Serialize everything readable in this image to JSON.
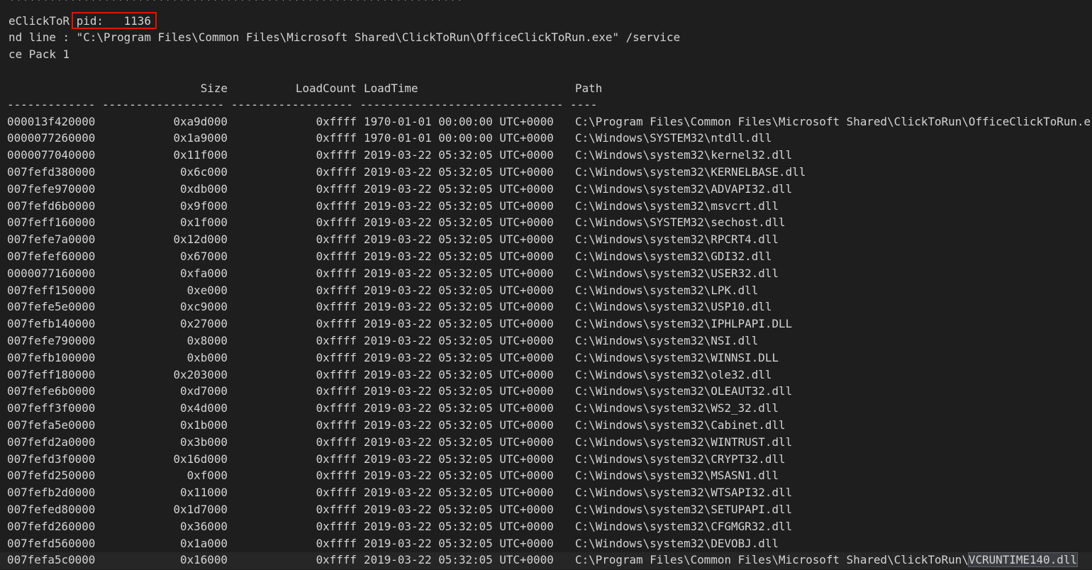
{
  "header": {
    "stars": "*******************************************************************",
    "proc_name": "eClickToR",
    "pid_label": "pid:",
    "pid_value": "1136",
    "command_line": "nd line : \"C:\\Program Files\\Common Files\\Microsoft Shared\\ClickToRun\\OfficeClickToRun.exe\" /service",
    "service_pack": "ce Pack 1"
  },
  "table": {
    "columns": {
      "size": "Size",
      "loadcount": "LoadCount",
      "loadtime": "LoadTime",
      "path": "Path"
    },
    "separator": "------------- ------------------ ------------------ ------------------------------ ----",
    "rows": [
      {
        "base": "000013f420000",
        "size": "0xa9d000",
        "loadcount": "0xffff",
        "loadtime": "1970-01-01 00:00:00 UTC+0000",
        "path": "C:\\Program Files\\Common Files\\Microsoft Shared\\ClickToRun\\OfficeClickToRun.e"
      },
      {
        "base": "0000077260000",
        "size": "0x1a9000",
        "loadcount": "0xffff",
        "loadtime": "1970-01-01 00:00:00 UTC+0000",
        "path": "C:\\Windows\\SYSTEM32\\ntdll.dll"
      },
      {
        "base": "0000077040000",
        "size": "0x11f000",
        "loadcount": "0xffff",
        "loadtime": "2019-03-22 05:32:05 UTC+0000",
        "path": "C:\\Windows\\system32\\kernel32.dll"
      },
      {
        "base": "007fefd380000",
        "size": "0x6c000",
        "loadcount": "0xffff",
        "loadtime": "2019-03-22 05:32:05 UTC+0000",
        "path": "C:\\Windows\\system32\\KERNELBASE.dll"
      },
      {
        "base": "007fefe970000",
        "size": "0xdb000",
        "loadcount": "0xffff",
        "loadtime": "2019-03-22 05:32:05 UTC+0000",
        "path": "C:\\Windows\\system32\\ADVAPI32.dll"
      },
      {
        "base": "007fefd6b0000",
        "size": "0x9f000",
        "loadcount": "0xffff",
        "loadtime": "2019-03-22 05:32:05 UTC+0000",
        "path": "C:\\Windows\\system32\\msvcrt.dll"
      },
      {
        "base": "007feff160000",
        "size": "0x1f000",
        "loadcount": "0xffff",
        "loadtime": "2019-03-22 05:32:05 UTC+0000",
        "path": "C:\\Windows\\SYSTEM32\\sechost.dll"
      },
      {
        "base": "007fefe7a0000",
        "size": "0x12d000",
        "loadcount": "0xffff",
        "loadtime": "2019-03-22 05:32:05 UTC+0000",
        "path": "C:\\Windows\\system32\\RPCRT4.dll"
      },
      {
        "base": "007fefef60000",
        "size": "0x67000",
        "loadcount": "0xffff",
        "loadtime": "2019-03-22 05:32:05 UTC+0000",
        "path": "C:\\Windows\\system32\\GDI32.dll"
      },
      {
        "base": "0000077160000",
        "size": "0xfa000",
        "loadcount": "0xffff",
        "loadtime": "2019-03-22 05:32:05 UTC+0000",
        "path": "C:\\Windows\\system32\\USER32.dll"
      },
      {
        "base": "007feff150000",
        "size": "0xe000",
        "loadcount": "0xffff",
        "loadtime": "2019-03-22 05:32:05 UTC+0000",
        "path": "C:\\Windows\\system32\\LPK.dll"
      },
      {
        "base": "007fefe5e0000",
        "size": "0xc9000",
        "loadcount": "0xffff",
        "loadtime": "2019-03-22 05:32:05 UTC+0000",
        "path": "C:\\Windows\\system32\\USP10.dll"
      },
      {
        "base": "007fefb140000",
        "size": "0x27000",
        "loadcount": "0xffff",
        "loadtime": "2019-03-22 05:32:05 UTC+0000",
        "path": "C:\\Windows\\system32\\IPHLPAPI.DLL"
      },
      {
        "base": "007fefe790000",
        "size": "0x8000",
        "loadcount": "0xffff",
        "loadtime": "2019-03-22 05:32:05 UTC+0000",
        "path": "C:\\Windows\\system32\\NSI.dll"
      },
      {
        "base": "007fefb100000",
        "size": "0xb000",
        "loadcount": "0xffff",
        "loadtime": "2019-03-22 05:32:05 UTC+0000",
        "path": "C:\\Windows\\system32\\WINNSI.DLL"
      },
      {
        "base": "007feff180000",
        "size": "0x203000",
        "loadcount": "0xffff",
        "loadtime": "2019-03-22 05:32:05 UTC+0000",
        "path": "C:\\Windows\\system32\\ole32.dll"
      },
      {
        "base": "007fefe6b0000",
        "size": "0xd7000",
        "loadcount": "0xffff",
        "loadtime": "2019-03-22 05:32:05 UTC+0000",
        "path": "C:\\Windows\\system32\\OLEAUT32.dll"
      },
      {
        "base": "007feff3f0000",
        "size": "0x4d000",
        "loadcount": "0xffff",
        "loadtime": "2019-03-22 05:32:05 UTC+0000",
        "path": "C:\\Windows\\system32\\WS2_32.dll"
      },
      {
        "base": "007fefa5e0000",
        "size": "0x1b000",
        "loadcount": "0xffff",
        "loadtime": "2019-03-22 05:32:05 UTC+0000",
        "path": "C:\\Windows\\system32\\Cabinet.dll"
      },
      {
        "base": "007fefd2a0000",
        "size": "0x3b000",
        "loadcount": "0xffff",
        "loadtime": "2019-03-22 05:32:05 UTC+0000",
        "path": "C:\\Windows\\system32\\WINTRUST.dll"
      },
      {
        "base": "007fefd3f0000",
        "size": "0x16d000",
        "loadcount": "0xffff",
        "loadtime": "2019-03-22 05:32:05 UTC+0000",
        "path": "C:\\Windows\\system32\\CRYPT32.dll"
      },
      {
        "base": "007fefd250000",
        "size": "0xf000",
        "loadcount": "0xffff",
        "loadtime": "2019-03-22 05:32:05 UTC+0000",
        "path": "C:\\Windows\\system32\\MSASN1.dll"
      },
      {
        "base": "007fefb2d0000",
        "size": "0x11000",
        "loadcount": "0xffff",
        "loadtime": "2019-03-22 05:32:05 UTC+0000",
        "path": "C:\\Windows\\system32\\WTSAPI32.dll"
      },
      {
        "base": "007fefed80000",
        "size": "0x1d7000",
        "loadcount": "0xffff",
        "loadtime": "2019-03-22 05:32:05 UTC+0000",
        "path": "C:\\Windows\\system32\\SETUPAPI.dll"
      },
      {
        "base": "007fefd260000",
        "size": "0x36000",
        "loadcount": "0xffff",
        "loadtime": "2019-03-22 05:32:05 UTC+0000",
        "path": "C:\\Windows\\system32\\CFGMGR32.dll"
      },
      {
        "base": "007fefd560000",
        "size": "0x1a000",
        "loadcount": "0xffff",
        "loadtime": "2019-03-22 05:32:05 UTC+0000",
        "path": "C:\\Windows\\system32\\DEVOBJ.dll"
      },
      {
        "base": "007fefa5c0000",
        "size": "0x16000",
        "loadcount": "0xffff",
        "loadtime": "2019-03-22 05:32:05 UTC+0000",
        "path": "C:\\Program Files\\Common Files\\Microsoft Shared\\ClickToRun\\",
        "path_selected": "VCRUNTIME140.dll"
      }
    ]
  },
  "colors": {
    "background": "#1e1e1e",
    "text": "#d4d4d4",
    "highlight_box": "#e51400",
    "selection": "#3a3d41"
  }
}
